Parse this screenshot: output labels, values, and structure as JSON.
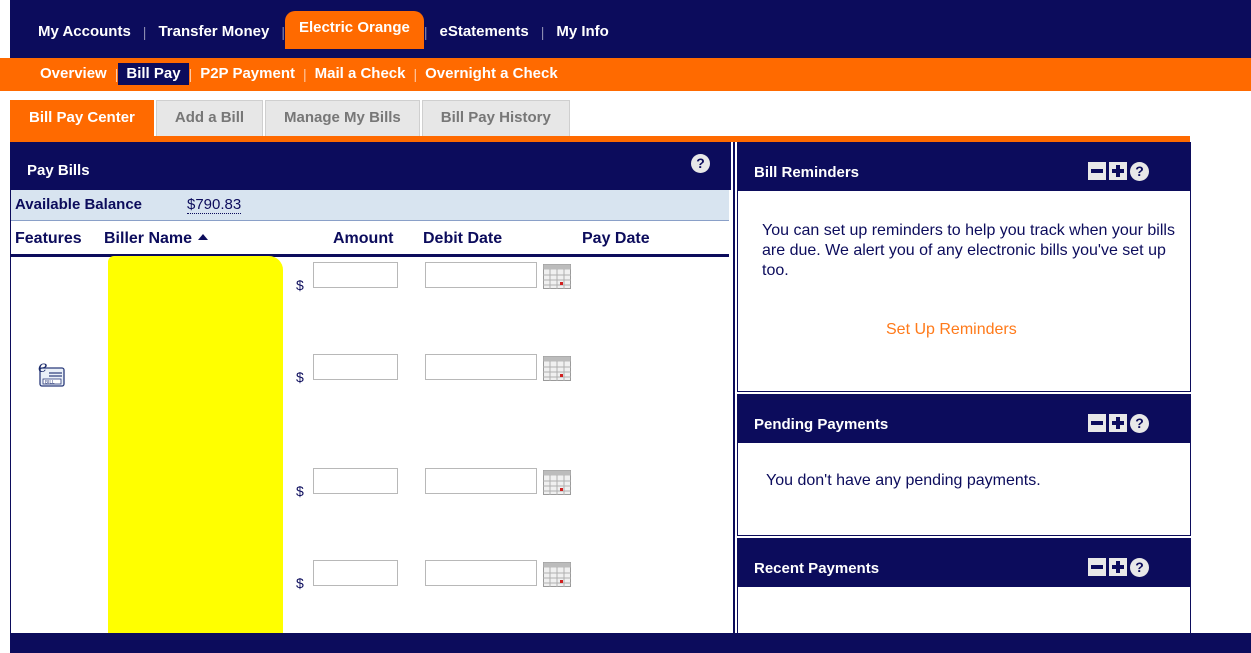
{
  "top_nav": [
    "My Accounts",
    "Transfer Money",
    "Electric Orange",
    "eStatements",
    "My Info"
  ],
  "sub_nav": [
    "Overview",
    "Bill Pay",
    "P2P Payment",
    "Mail a Check",
    "Overnight a Check"
  ],
  "page_tabs": [
    "Bill Pay Center",
    "Add a Bill",
    "Manage My Bills",
    "Bill Pay History"
  ],
  "pay_bills": {
    "title": "Pay Bills",
    "balance_label": "Available Balance",
    "balance_value": "$790.83",
    "columns": {
      "features": "Features",
      "biller": "Biller Name",
      "amount": "Amount",
      "debit": "Debit Date",
      "pay": "Pay Date"
    },
    "currency": "$",
    "ebill_icon": "e-bill-icon",
    "calendar_icon": "calendar-icon"
  },
  "reminders": {
    "title": "Bill Reminders",
    "text": "You can set up reminders to help you track when your bills are due. We alert you of any electronic bills you've set up too.",
    "link": "Set Up Reminders"
  },
  "pending": {
    "title": "Pending Payments",
    "text": "You don't have any pending payments."
  },
  "recent": {
    "title": "Recent Payments"
  },
  "colors": {
    "navy": "#0c0c5c",
    "orange": "#ff6a00",
    "link_orange": "#ff7a1a",
    "balance_bg": "#d8e4f0"
  }
}
